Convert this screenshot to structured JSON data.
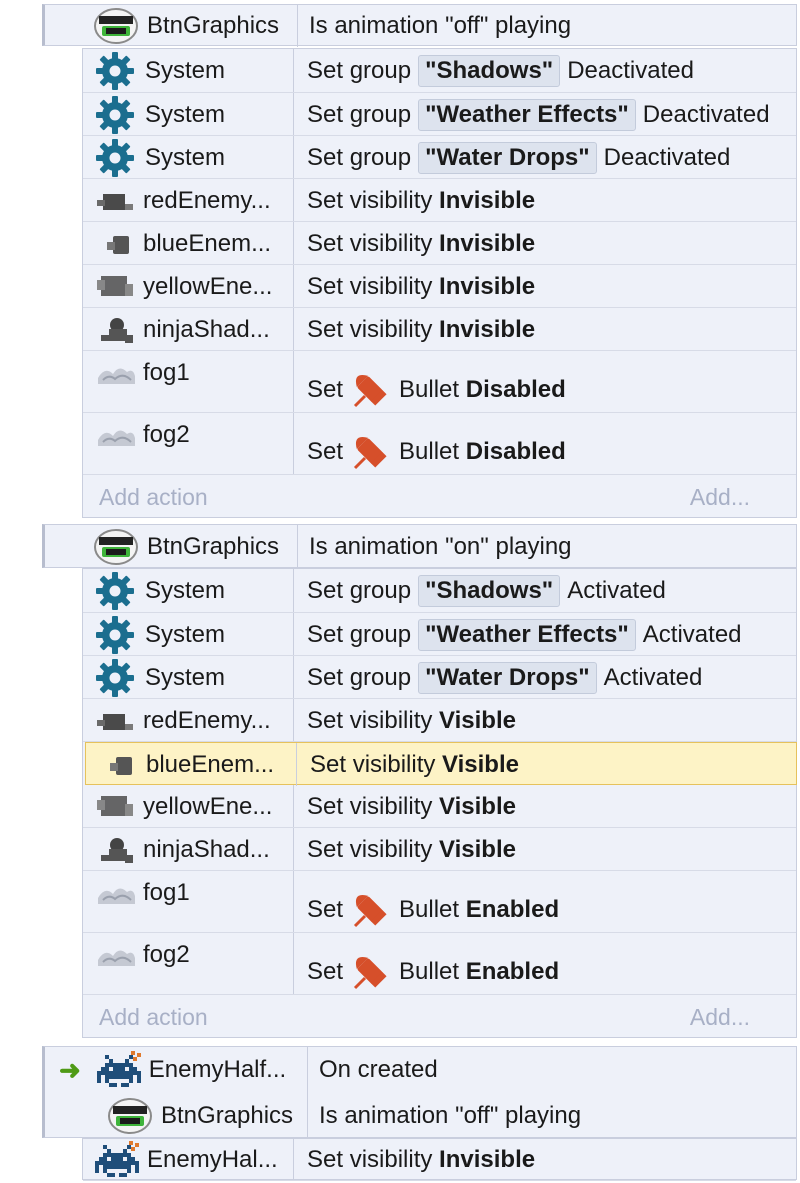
{
  "colors": {
    "gear": "#1b6e8f",
    "bullet": "#d64f2a",
    "arrow": "#4e9a16",
    "highlight": "#fdf3c6",
    "placeholder": "#a8b0c6"
  },
  "events": [
    {
      "conditions": [
        {
          "icon": "details-max-logo",
          "object": "BtnGraphics",
          "text": "Is animation \"off\" playing"
        }
      ],
      "actions": [
        {
          "icon": "gear-icon",
          "object": "System",
          "pre": "Set group",
          "badge": "\"Shadows\"",
          "post": "Deactivated"
        },
        {
          "icon": "gear-icon",
          "object": "System",
          "pre": "Set group",
          "badge": "\"Weather Effects\"",
          "post": "Deactivated"
        },
        {
          "icon": "gear-icon",
          "object": "System",
          "pre": "Set group",
          "badge": "\"Water Drops\"",
          "post": "Deactivated"
        },
        {
          "icon": "red-enemy-sprite-icon",
          "object": "redEnemy...",
          "pre": "Set visibility",
          "bold": "Invisible"
        },
        {
          "icon": "blue-enemy-sprite-icon",
          "object": "blueEnem...",
          "pre": "Set visibility",
          "bold": "Invisible"
        },
        {
          "icon": "yellow-enemy-sprite-icon",
          "object": "yellowEne...",
          "pre": "Set visibility",
          "bold": "Invisible"
        },
        {
          "icon": "ninja-shadow-sprite-icon",
          "object": "ninjaShad...",
          "pre": "Set visibility",
          "bold": "Invisible"
        },
        {
          "icon": "fog-sprite-icon",
          "object": "fog1",
          "pre": "Set",
          "mid": "Bullet",
          "bold": "Disabled"
        },
        {
          "icon": "fog-sprite-icon",
          "object": "fog2",
          "pre": "Set",
          "mid": "Bullet",
          "bold": "Disabled"
        }
      ],
      "add_action": "Add action",
      "add": "Add..."
    },
    {
      "conditions": [
        {
          "icon": "details-max-logo",
          "object": "BtnGraphics",
          "text": "Is animation \"on\" playing"
        }
      ],
      "actions": [
        {
          "icon": "gear-icon",
          "object": "System",
          "pre": "Set group",
          "badge": "\"Shadows\"",
          "post": "Activated"
        },
        {
          "icon": "gear-icon",
          "object": "System",
          "pre": "Set group",
          "badge": "\"Weather Effects\"",
          "post": "Activated"
        },
        {
          "icon": "gear-icon",
          "object": "System",
          "pre": "Set group",
          "badge": "\"Water Drops\"",
          "post": "Activated"
        },
        {
          "icon": "red-enemy-sprite-icon",
          "object": "redEnemy...",
          "pre": "Set visibility",
          "bold": "Visible"
        },
        {
          "icon": "blue-enemy-sprite-icon",
          "object": "blueEnem...",
          "pre": "Set visibility",
          "bold": "Visible",
          "selected": true
        },
        {
          "icon": "yellow-enemy-sprite-icon",
          "object": "yellowEne...",
          "pre": "Set visibility",
          "bold": "Visible"
        },
        {
          "icon": "ninja-shadow-sprite-icon",
          "object": "ninjaShad...",
          "pre": "Set visibility",
          "bold": "Visible"
        },
        {
          "icon": "fog-sprite-icon",
          "object": "fog1",
          "pre": "Set",
          "mid": "Bullet",
          "bold": "Enabled"
        },
        {
          "icon": "fog-sprite-icon",
          "object": "fog2",
          "pre": "Set",
          "mid": "Bullet",
          "bold": "Enabled"
        }
      ],
      "add_action": "Add action",
      "add": "Add..."
    },
    {
      "conditions": [
        {
          "icon": "space-invader-icon",
          "object": "EnemyHalf...",
          "text": "On created",
          "trigger": true
        },
        {
          "icon": "details-max-logo",
          "object": "BtnGraphics",
          "text": "Is animation \"off\" playing"
        }
      ],
      "actions": [
        {
          "icon": "space-invader-icon",
          "object": "EnemyHal...",
          "pre": "Set visibility",
          "bold": "Invisible"
        }
      ]
    }
  ]
}
